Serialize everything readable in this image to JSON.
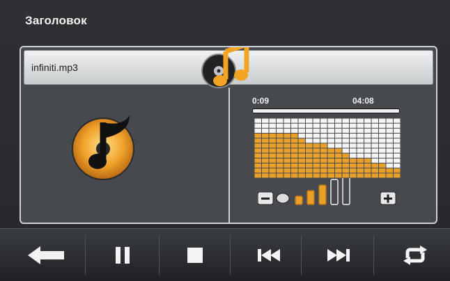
{
  "header": {
    "title": "Заголовок"
  },
  "player": {
    "file_name": "infiniti.mp3",
    "elapsed": "0:09",
    "total": "04:08",
    "progress_fraction": 0.04,
    "equalizer_levels": [
      9,
      9,
      9,
      9,
      9,
      9,
      8,
      7,
      7,
      7,
      6,
      6,
      5,
      4,
      4,
      4,
      3,
      3,
      2,
      2
    ],
    "equalizer_max": 12,
    "volume_level": 3,
    "volume_steps": 5
  },
  "controls": {
    "back": "back-arrow-icon",
    "pause": "pause-icon",
    "stop": "stop-icon",
    "prev": "previous-track-icon",
    "next": "next-track-icon",
    "repeat": "repeat-icon"
  },
  "colors": {
    "accent": "#e8a02a",
    "text": "#f2f2f2",
    "panel": "#46494e",
    "button_icon": "#f4f4f4"
  }
}
